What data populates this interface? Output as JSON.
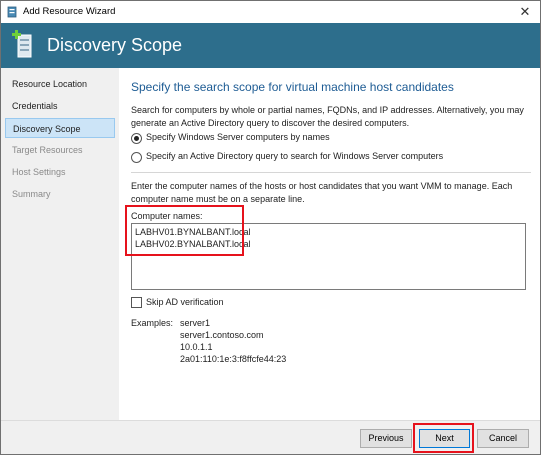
{
  "window": {
    "title": "Add Resource Wizard",
    "close_glyph": "✕"
  },
  "banner": {
    "title": "Discovery Scope"
  },
  "sidebar": {
    "items": [
      {
        "label": "Resource Location"
      },
      {
        "label": "Credentials"
      },
      {
        "label": "Discovery Scope"
      },
      {
        "label": "Target Resources"
      },
      {
        "label": "Host Settings"
      },
      {
        "label": "Summary"
      }
    ]
  },
  "main": {
    "heading": "Specify the search scope for virtual machine host candidates",
    "description": "Search for computers by whole or partial names, FQDNs, and IP addresses. Alternatively, you may generate an Active Directory query to discover the desired computers.",
    "options": [
      {
        "label": "Specify Windows Server computers by names",
        "selected": true
      },
      {
        "label": "Specify an Active Directory query to search for Windows Server computers",
        "selected": false
      }
    ],
    "enter_description": "Enter the computer names of the hosts or host candidates that you want VMM to manage. Each computer name must be on a separate line.",
    "names_label": "Computer names:",
    "names": [
      "LABHV01.BYNALBANT.local",
      "LABHV02.BYNALBANT.local"
    ],
    "skip_ad_label": "Skip AD verification",
    "skip_ad_checked": false,
    "examples_label": "Examples:",
    "examples": [
      "server1",
      "server1.contoso.com",
      "10.0.1.1",
      "2a01:110:1e:3:f8ffcfe44:23"
    ]
  },
  "footer": {
    "previous_label": "Previous",
    "next_label": "Next",
    "cancel_label": "Cancel"
  },
  "colors": {
    "banner": "#2d6e8c",
    "heading": "#1e5c94",
    "highlight": "#e6121c",
    "active_nav": "#cce4f7"
  }
}
